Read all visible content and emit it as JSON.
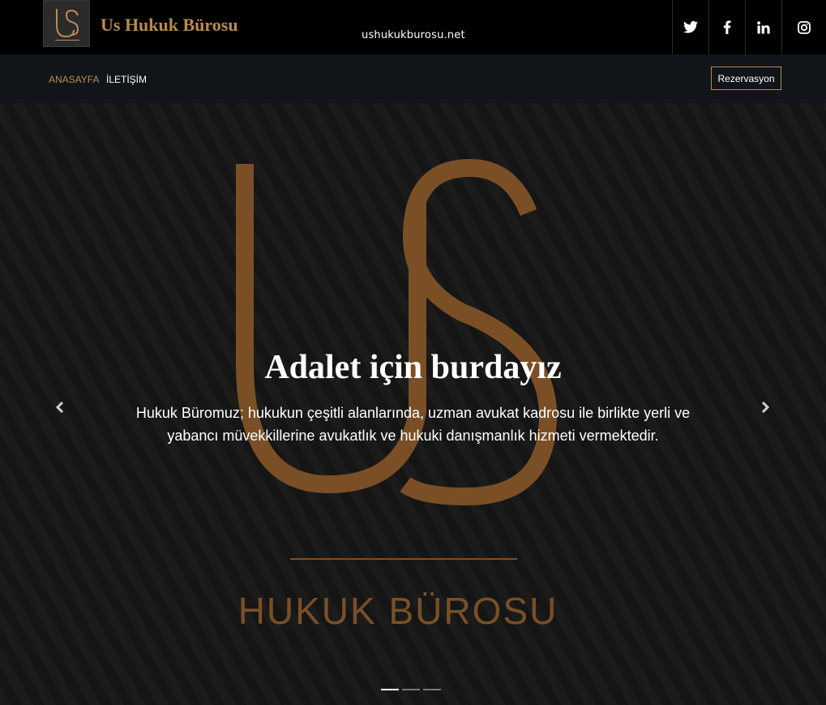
{
  "header": {
    "brand": "Us Hukuk Bürosu",
    "domain": "ushukukburosu.net",
    "logo_text": "US",
    "social": [
      {
        "name": "twitter-icon"
      },
      {
        "name": "facebook-icon"
      },
      {
        "name": "linkedin-icon"
      },
      {
        "name": "instagram-icon"
      }
    ]
  },
  "nav": {
    "home": "ANASAYFA",
    "contact": "İLETİŞİM",
    "reserve": "Rezervasyon"
  },
  "hero": {
    "title": "Adalet için burdayız",
    "subtitle": "Hukuk Büromuz; hukukun çeşitli alanlarında, uzman avukat kadrosu ile birlikte yerli ve yabancı müvekkillerine avukatlık ve hukuki danışmanlık hizmeti vermektedir.",
    "logo_caption": "HUKUK BÜROSU",
    "slide_count": 3,
    "active_slide": 1
  },
  "colors": {
    "accent": "#b98a52",
    "logo_brown": "#7a4f26",
    "nav_bg": "#111419"
  }
}
